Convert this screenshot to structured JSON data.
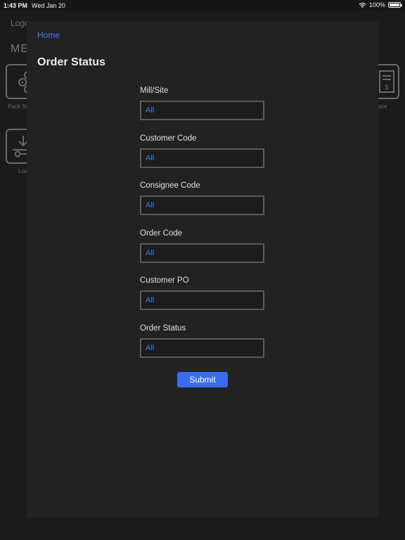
{
  "status_bar": {
    "time": "1:43 PM",
    "date": "Wed Jan 20",
    "battery": "100%"
  },
  "background": {
    "logo": "Logo",
    "menu": "ME",
    "tiles": [
      {
        "label": "Pack Sc",
        "icon": "rolls-icon"
      },
      {
        "label": "Loa",
        "icon": "download-icon"
      },
      {
        "label": "oice",
        "icon": "invoice-icon"
      }
    ]
  },
  "sheet": {
    "home_link": "Home",
    "title": "Order Status",
    "fields": [
      {
        "label": "Mill/Site",
        "value": "All"
      },
      {
        "label": "Customer Code",
        "value": "All"
      },
      {
        "label": "Consignee Code",
        "value": "All"
      },
      {
        "label": "Order Code",
        "value": "All"
      },
      {
        "label": "Customer PO",
        "value": "All"
      },
      {
        "label": "Order Status",
        "value": "All"
      }
    ],
    "submit_label": "Submit"
  },
  "colors": {
    "accent": "#3f7cf5",
    "button": "#3b6cf0",
    "sheet_bg": "#222222",
    "page_bg": "#161616"
  }
}
